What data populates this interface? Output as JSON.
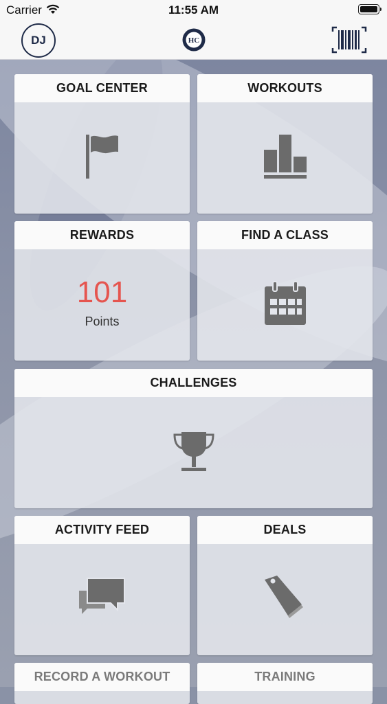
{
  "status_bar": {
    "carrier": "Carrier",
    "time": "11:55 AM"
  },
  "nav": {
    "avatar_initials": "DJ",
    "logo_icon": "club-logo",
    "barcode_icon": "barcode-scan-icon"
  },
  "tiles": {
    "goal_center": {
      "title": "GOAL CENTER",
      "icon": "flag-icon"
    },
    "workouts": {
      "title": "WORKOUTS",
      "icon": "bar-chart-icon"
    },
    "rewards": {
      "title": "REWARDS",
      "points_value": "101",
      "points_label": "Points"
    },
    "find_a_class": {
      "title": "FIND A CLASS",
      "icon": "calendar-icon"
    },
    "challenges": {
      "title": "CHALLENGES",
      "icon": "trophy-icon"
    },
    "activity_feed": {
      "title": "ACTIVITY FEED",
      "icon": "chat-bubbles-icon"
    },
    "deals": {
      "title": "DEALS",
      "icon": "tag-icon"
    },
    "record_a_workout": {
      "title": "RECORD A WORKOUT"
    },
    "training": {
      "title": "TRAINING"
    }
  },
  "colors": {
    "accent_points": "#e5554f",
    "navy": "#1f2b48",
    "icon_gray": "#6b6b6b"
  }
}
